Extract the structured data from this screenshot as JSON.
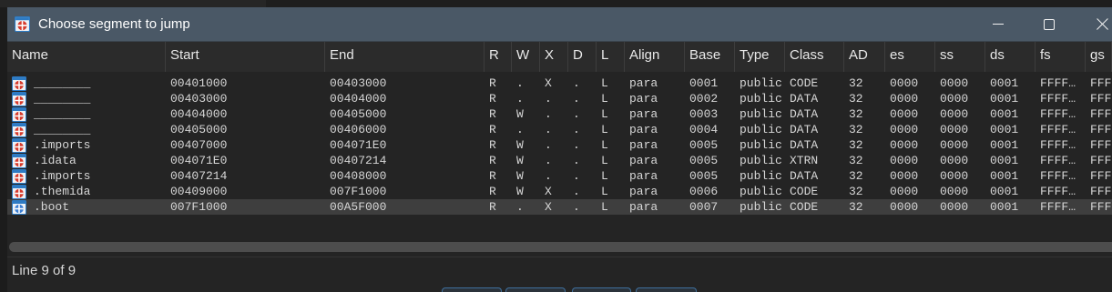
{
  "window": {
    "title": "Choose segment to jump",
    "icon": "segment-chooser-icon",
    "controls": [
      "minimize-icon",
      "maximize-icon",
      "close-icon"
    ]
  },
  "colors": {
    "title_bar": "#4a5866",
    "background": "#242424",
    "header": "#2b2b2b",
    "selected_row": "#3e3e3e",
    "text": "#d6d6d6",
    "icon_red": "#d63a2c",
    "icon_blue": "#3b7fd4",
    "icon_frame": "#2e7bc4",
    "button_border": "#3f6f9c"
  },
  "table": {
    "columns": [
      "Name",
      "Start",
      "End",
      "R",
      "W",
      "X",
      "D",
      "L",
      "Align",
      "Base",
      "Type",
      "Class",
      "AD",
      "es",
      "ss",
      "ds",
      "fs",
      "gs"
    ],
    "selected_row": 8,
    "rows": [
      {
        "icon": "segment-icon",
        "cells": [
          "________",
          "00401000",
          "00403000",
          "R",
          ".",
          "X",
          ".",
          "L",
          "para",
          "0001",
          "public",
          "CODE",
          "32",
          "0000",
          "0000",
          "0001",
          "FFFF…",
          "FFFF"
        ]
      },
      {
        "icon": "segment-icon",
        "cells": [
          "________",
          "00403000",
          "00404000",
          "R",
          ".",
          ".",
          ".",
          "L",
          "para",
          "0002",
          "public",
          "DATA",
          "32",
          "0000",
          "0000",
          "0001",
          "FFFF…",
          "FFFF"
        ]
      },
      {
        "icon": "segment-icon",
        "cells": [
          "________",
          "00404000",
          "00405000",
          "R",
          "W",
          ".",
          ".",
          "L",
          "para",
          "0003",
          "public",
          "DATA",
          "32",
          "0000",
          "0000",
          "0001",
          "FFFF…",
          "FFFF"
        ]
      },
      {
        "icon": "segment-icon",
        "cells": [
          "________",
          "00405000",
          "00406000",
          "R",
          ".",
          ".",
          ".",
          "L",
          "para",
          "0004",
          "public",
          "DATA",
          "32",
          "0000",
          "0000",
          "0001",
          "FFFF…",
          "FFFF"
        ]
      },
      {
        "icon": "segment-icon",
        "cells": [
          ".imports",
          "00407000",
          "004071E0",
          "R",
          "W",
          ".",
          ".",
          "L",
          "para",
          "0005",
          "public",
          "DATA",
          "32",
          "0000",
          "0000",
          "0001",
          "FFFF…",
          "FFFF"
        ]
      },
      {
        "icon": "segment-icon",
        "cells": [
          ".idata",
          "004071E0",
          "00407214",
          "R",
          "W",
          ".",
          ".",
          "L",
          "para",
          "0005",
          "public",
          "XTRN",
          "32",
          "0000",
          "0000",
          "0001",
          "FFFF…",
          "FFFF"
        ]
      },
      {
        "icon": "segment-icon",
        "cells": [
          ".imports",
          "00407214",
          "00408000",
          "R",
          "W",
          ".",
          ".",
          "L",
          "para",
          "0005",
          "public",
          "DATA",
          "32",
          "0000",
          "0000",
          "0001",
          "FFFF…",
          "FFFF"
        ]
      },
      {
        "icon": "segment-icon",
        "cells": [
          ".themida",
          "00409000",
          "007F1000",
          "R",
          "W",
          "X",
          ".",
          "L",
          "para",
          "0006",
          "public",
          "CODE",
          "32",
          "0000",
          "0000",
          "0001",
          "FFFF…",
          "FFFF"
        ]
      },
      {
        "icon": "segment-icon-blue",
        "cells": [
          ".boot",
          "007F1000",
          "00A5F000",
          "R",
          ".",
          "X",
          ".",
          "L",
          "para",
          "0007",
          "public",
          "CODE",
          "32",
          "0000",
          "0000",
          "0001",
          "FFFF…",
          "FFFF"
        ]
      }
    ]
  },
  "scrollbar": {
    "horizontal_scroll": 0
  },
  "status": {
    "line": "Line 9 of 9"
  }
}
